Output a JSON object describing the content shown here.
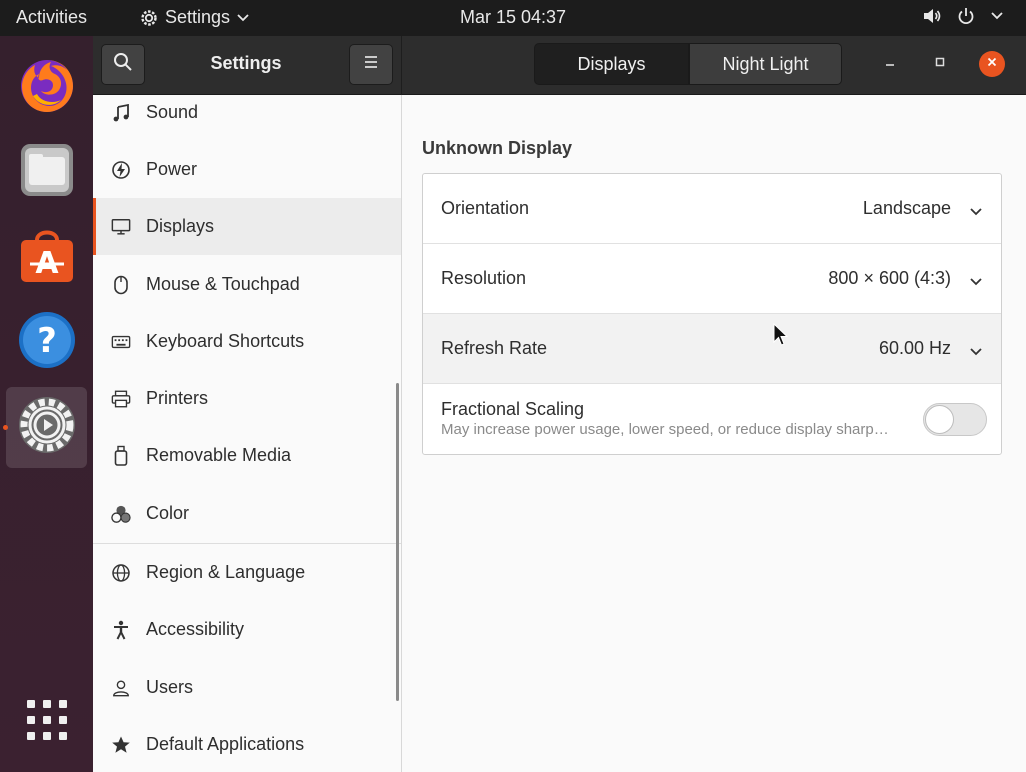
{
  "topbar": {
    "activities": "Activities",
    "app_name": "Settings",
    "clock": "Mar 15  04:37"
  },
  "dock": {
    "items": [
      {
        "name": "firefox-icon"
      },
      {
        "name": "files-icon"
      },
      {
        "name": "software-icon"
      },
      {
        "name": "help-icon"
      },
      {
        "name": "settings-icon",
        "active": true
      }
    ],
    "accent": "#e95420"
  },
  "headerbar": {
    "title": "Settings",
    "tabs": [
      "Displays",
      "Night Light"
    ]
  },
  "sidebar": {
    "items": [
      {
        "label": "Sound",
        "icon": "music-note-icon"
      },
      {
        "label": "Power",
        "icon": "power-icon"
      },
      {
        "label": "Displays",
        "icon": "display-icon",
        "active": true
      },
      {
        "label": "Mouse & Touchpad",
        "icon": "mouse-icon"
      },
      {
        "label": "Keyboard Shortcuts",
        "icon": "keyboard-icon"
      },
      {
        "label": "Printers",
        "icon": "printer-icon"
      },
      {
        "label": "Removable Media",
        "icon": "removable-media-icon"
      },
      {
        "label": "Color",
        "icon": "color-icon"
      },
      {
        "label": "Region & Language",
        "icon": "globe-icon"
      },
      {
        "label": "Accessibility",
        "icon": "accessibility-icon"
      },
      {
        "label": "Users",
        "icon": "users-icon"
      },
      {
        "label": "Default Applications",
        "icon": "star-icon"
      }
    ]
  },
  "display": {
    "section_title": "Unknown Display",
    "orientation": {
      "label": "Orientation",
      "value": "Landscape"
    },
    "resolution": {
      "label": "Resolution",
      "value": "800 × 600 (4:3)"
    },
    "refresh_rate": {
      "label": "Refresh Rate",
      "value": "60.00 Hz"
    },
    "fractional_scaling": {
      "label": "Fractional Scaling",
      "description": "May increase power usage, lower speed, or reduce display sharp…",
      "enabled": false
    }
  }
}
